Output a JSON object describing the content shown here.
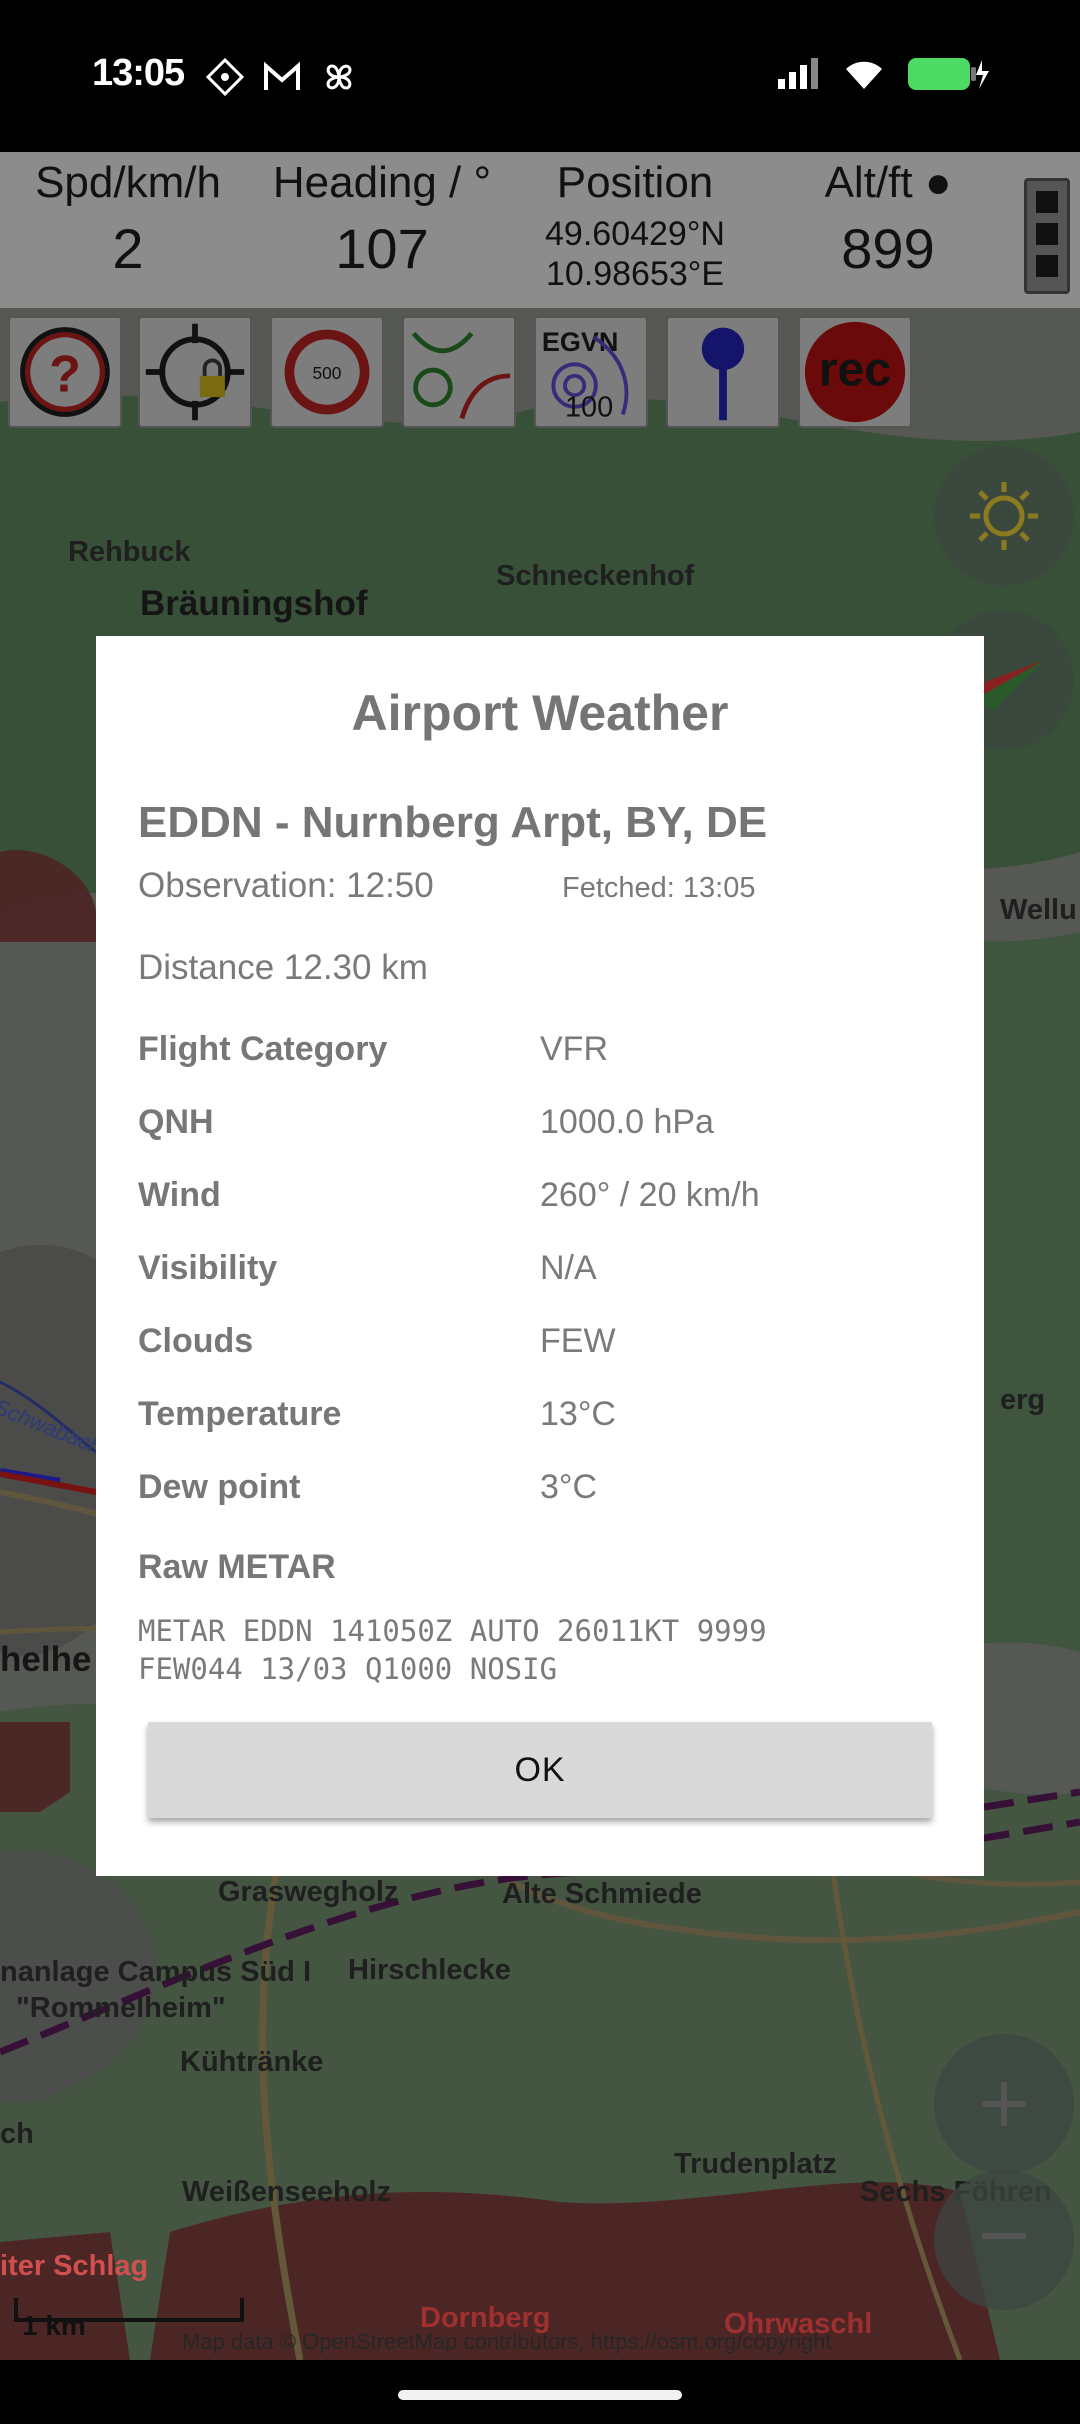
{
  "status_bar": {
    "time": "13:05",
    "left_icons": [
      "diamond-icon",
      "gmail-icon",
      "pinwheel-icon"
    ],
    "right_icons": [
      "cellular-signal-icon",
      "wifi-icon",
      "battery-charging-icon"
    ],
    "battery_color": "#4cd964"
  },
  "nav_strip": {
    "speed_label": "Spd/km/h",
    "speed_value": "2",
    "heading_label": "Heading / °",
    "heading_value": "107",
    "position_label": "Position",
    "latitude": "49.60429°N",
    "longitude": "10.98653°E",
    "altitude_label": "Alt/ft ●",
    "altitude_value": "899"
  },
  "toolbar": {
    "tools": [
      "help-icon",
      "lock-target-icon",
      "speed-limit-icon",
      "traffic-curves-icon",
      "airspace-icon",
      "pin-icon",
      "record-icon"
    ],
    "speed_limit_text": "500",
    "airspace_text": "EGVN",
    "airspace_sub": "100",
    "record_text": "rec",
    "record_color": "#cc0000"
  },
  "map": {
    "labels": {
      "rehbuck": "Rehbuck",
      "braeuningshof": "Bräuningshof",
      "schneckenhof": "Schneckenhof",
      "wellu": "Wellu",
      "erg": "erg",
      "helhe": "helhe",
      "schwabach": "Schwabach",
      "graswegholz": "Graswegholz",
      "alte_schmiede": "Alte Schmiede",
      "campus": "nanlage Campus Süd I",
      "rommelheim": "\"Rommelheim\"",
      "hirschlecke": "Hirschlecke",
      "kuehtraenke": "Kühtränke",
      "ch": "ch",
      "trudenplatz": "Trudenplatz",
      "weissenseeholz": "Weißenseeholz",
      "sechs_foehren": "Sechs Föhren",
      "iter_schlag": "iter Schlag",
      "dornberg": "Dornberg",
      "ohrwaschl": "Ohrwaschl"
    },
    "scale": "1 km",
    "copyright": "Map data © OpenStreetMap contributors, https://osm.org/copyright"
  },
  "dialog": {
    "title": "Airport Weather",
    "station": "EDDN - Nurnberg Arpt, BY, DE",
    "observation": "Observation: 12:50",
    "fetched": "Fetched: 13:05",
    "distance": "Distance 12.30 km",
    "rows": [
      {
        "label": "Flight Category",
        "value": "VFR"
      },
      {
        "label": "QNH",
        "value": "1000.0 hPa"
      },
      {
        "label": "Wind",
        "value": "260° / 20 km/h"
      },
      {
        "label": "Visibility",
        "value": "N/A"
      },
      {
        "label": "Clouds",
        "value": "FEW"
      },
      {
        "label": "Temperature",
        "value": "13°C"
      },
      {
        "label": "Dew point",
        "value": "3°C"
      }
    ],
    "raw_label": "Raw METAR",
    "raw_metar": "METAR EDDN 141050Z AUTO 26011KT 9999\nFEW044 13/03 Q1000 NOSIG",
    "ok_label": "OK"
  }
}
